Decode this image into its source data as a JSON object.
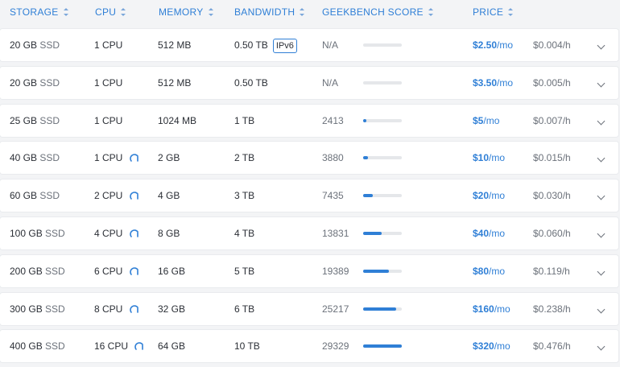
{
  "header": {
    "columns": [
      {
        "key": "storage",
        "label": "STORAGE"
      },
      {
        "key": "cpu",
        "label": "CPU"
      },
      {
        "key": "memory",
        "label": "MEMORY"
      },
      {
        "key": "bandwidth",
        "label": "BANDWIDTH"
      },
      {
        "key": "geekbench",
        "label": "GEEKBENCH SCORE"
      },
      {
        "key": "price",
        "label": "PRICE"
      }
    ]
  },
  "rows": [
    {
      "storage_num": "20 GB",
      "storage_unit": "SSD",
      "cpu": "1 CPU",
      "cpu_icon": false,
      "memory": "512 MB",
      "bandwidth": "0.50 TB",
      "badge": "IPv6",
      "score": "N/A",
      "score_fraction": 0,
      "price": "$2.50",
      "per": "/mo",
      "hourly": "$0.004/h"
    },
    {
      "storage_num": "20 GB",
      "storage_unit": "SSD",
      "cpu": "1 CPU",
      "cpu_icon": false,
      "memory": "512 MB",
      "bandwidth": "0.50 TB",
      "badge": "",
      "score": "N/A",
      "score_fraction": 0,
      "price": "$3.50",
      "per": "/mo",
      "hourly": "$0.005/h"
    },
    {
      "storage_num": "25 GB",
      "storage_unit": "SSD",
      "cpu": "1 CPU",
      "cpu_icon": false,
      "memory": "1024 MB",
      "bandwidth": "1 TB",
      "badge": "",
      "score": "2413",
      "score_fraction": 0.08,
      "price": "$5",
      "per": "/mo",
      "hourly": "$0.007/h"
    },
    {
      "storage_num": "40 GB",
      "storage_unit": "SSD",
      "cpu": "1 CPU",
      "cpu_icon": true,
      "memory": "2 GB",
      "bandwidth": "2 TB",
      "badge": "",
      "score": "3880",
      "score_fraction": 0.13,
      "price": "$10",
      "per": "/mo",
      "hourly": "$0.015/h"
    },
    {
      "storage_num": "60 GB",
      "storage_unit": "SSD",
      "cpu": "2 CPU",
      "cpu_icon": true,
      "memory": "4 GB",
      "bandwidth": "3 TB",
      "badge": "",
      "score": "7435",
      "score_fraction": 0.25,
      "price": "$20",
      "per": "/mo",
      "hourly": "$0.030/h"
    },
    {
      "storage_num": "100 GB",
      "storage_unit": "SSD",
      "cpu": "4 CPU",
      "cpu_icon": true,
      "memory": "8 GB",
      "bandwidth": "4 TB",
      "badge": "",
      "score": "13831",
      "score_fraction": 0.47,
      "price": "$40",
      "per": "/mo",
      "hourly": "$0.060/h"
    },
    {
      "storage_num": "200 GB",
      "storage_unit": "SSD",
      "cpu": "6 CPU",
      "cpu_icon": true,
      "memory": "16 GB",
      "bandwidth": "5 TB",
      "badge": "",
      "score": "19389",
      "score_fraction": 0.66,
      "price": "$80",
      "per": "/mo",
      "hourly": "$0.119/h"
    },
    {
      "storage_num": "300 GB",
      "storage_unit": "SSD",
      "cpu": "8 CPU",
      "cpu_icon": true,
      "memory": "32 GB",
      "bandwidth": "6 TB",
      "badge": "",
      "score": "25217",
      "score_fraction": 0.86,
      "price": "$160",
      "per": "/mo",
      "hourly": "$0.238/h"
    },
    {
      "storage_num": "400 GB",
      "storage_unit": "SSD",
      "cpu": "16 CPU",
      "cpu_icon": true,
      "memory": "64 GB",
      "bandwidth": "10 TB",
      "badge": "",
      "score": "29329",
      "score_fraction": 1.0,
      "price": "$320",
      "per": "/mo",
      "hourly": "$0.476/h"
    }
  ],
  "icons": {
    "sort": "sort-icon",
    "gauge": "speed-gauge-icon",
    "expand": "chevron-down-icon"
  },
  "colors": {
    "accent": "#2f7fd6",
    "row_bg": "#ffffff",
    "page_bg": "#f3f4f6"
  }
}
